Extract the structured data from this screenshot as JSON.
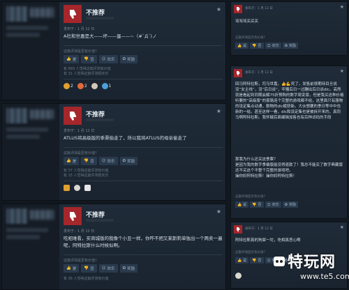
{
  "reviews_left": [
    {
      "verdict": "不推荐",
      "posted": "发布于：1 月 12 日",
      "text": "A社和世嘉是大——坏——蛋——~（#`Д´)ノ",
      "helpful_q": "这篇评测是否有价值？",
      "vote_yes": "是",
      "vote_no": "否",
      "vote_funny": "欢乐",
      "vote_award": "奖励",
      "stats": [
        "有 893 人觉得这篇评测有价值",
        "有 31 人觉得这篇评测很欢乐"
      ],
      "awards": [
        {
          "icon": "heart-eyes-icon",
          "count": "2",
          "color": "#e0a030"
        },
        {
          "icon": "laugh-icon",
          "count": "2",
          "color": "#e26a3a"
        },
        {
          "icon": "clown-icon",
          "count": "",
          "color": "#d0c8b8"
        },
        {
          "icon": "bulb-icon",
          "count": "1",
          "color": "#4aa0d8"
        }
      ]
    },
    {
      "verdict": "不推荐",
      "posted": "发布于：1 月 12 日",
      "text": "ATLUS将高级版的季票偷走了，所以我将ATLUS的母亲偷走了",
      "helpful_q": "这篇评测是否有价值？",
      "vote_yes": "是",
      "vote_no": "否",
      "vote_funny": "欢乐",
      "vote_award": "奖励",
      "stats": [
        "有 57 人觉得这篇评测有价值",
        "有 15 人觉得这篇评测很欢乐"
      ],
      "awards": [
        {
          "icon": "hand-icon",
          "count": "",
          "color": "#e0a030"
        },
        {
          "icon": "garlic-icon",
          "count": "",
          "color": "#d8d8d0"
        },
        {
          "icon": "camera-icon",
          "count": "",
          "color": "#e6e6e6"
        }
      ]
    },
    {
      "verdict": "不推荐",
      "posted": "发布于：1 月 12 日",
      "text": "吃相难看，买商城版的我像个小丑一样，你咋不把又莱斯莉单独出一个两卖一遍呢，阿特拉斯什么时候似啊。",
      "helpful_q": "这篇评测是否有价值？",
      "vote_yes": "是",
      "vote_no": "否",
      "vote_funny": "欢乐",
      "vote_award": "奖励",
      "stats": [
        "有 36 人觉得这篇评测有价值"
      ],
      "awards": []
    }
  ],
  "reviews_right": [
    {
      "posted": "发布于：1 月 12 日",
      "text": "骂骂骂买买买",
      "helpful_q": "这篇评测是否有价值？",
      "vote_yes": "是",
      "vote_no": "否",
      "vote_funny": "欢乐",
      "vote_award": "奖励"
    },
    {
      "posted": "发布于：1 月 12 日",
      "text": "回马阿特拉斯，司马世嘉，👍💪死了，发售前很期待目旦说没“女主线”，没“后日谈”，牢骚后日一过蹦出后日谈dlc。高然就是看起到同期会解75折预购的数字周变版，但是我买这种价格听要的“高级版”的套路连个完整的游戏都不给，这里面只有服物的设定集点动通，剧物的dlc螃获新。大伙想要的季日等中中也新的一给。甚至这样一看，dlc和设定集也是被拆开来的，真同马啊阿特拉斯。我怀疑后面编辑加售也有后种词码的手段",
      "text2": "那我为什么还买这季票？\n是因为我的数字季编版能没得退款了！我总不能买了数字典藏版还不买这个不整个完整的游戏吧。\n操你妈阿特拉斯！操你妈阿特拉斯！",
      "helpful_q": "这篇评测是否有价值？",
      "vote_yes": "是",
      "vote_no": "否",
      "vote_funny": "欢乐",
      "vote_award": "奖励"
    },
    {
      "posted": "发布于：1 月 12 日",
      "text": "阿特拉斯真的狗屎一坨，吃相真恶心啊",
      "helpful_q": "这篇评测是否有价值？",
      "vote_yes": "是",
      "vote_no": "否",
      "vote_funny": "欢乐",
      "vote_award": "奖励"
    }
  ],
  "watermark": {
    "title": "特玩网",
    "url": "www.te5.com"
  },
  "colors": {
    "thumb_down": "#a5262b",
    "panel": "#1f2b38",
    "background": "#121820"
  }
}
